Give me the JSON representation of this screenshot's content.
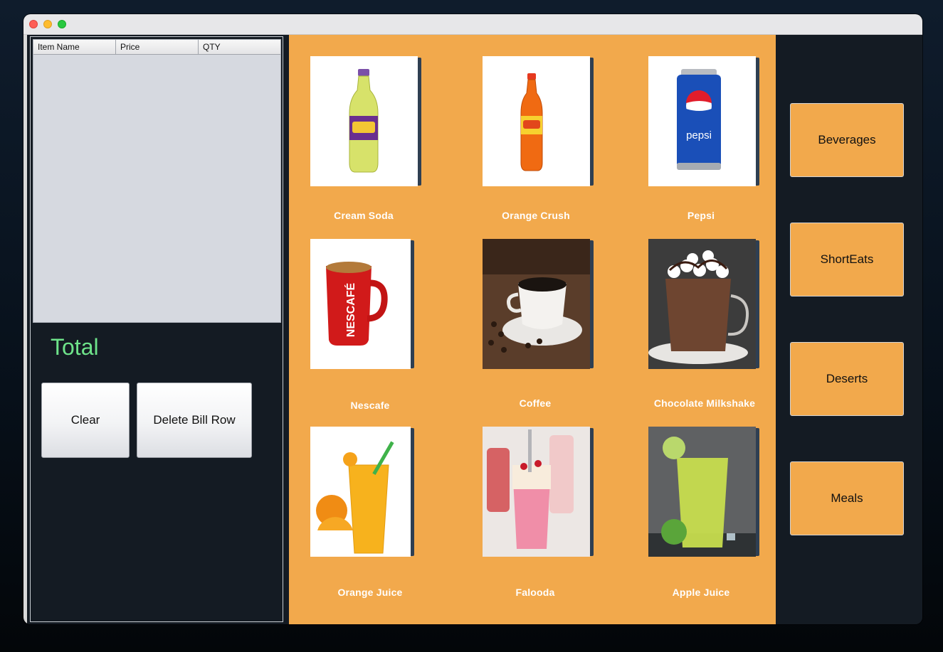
{
  "window": {
    "controls": [
      "close",
      "minimize",
      "zoom"
    ]
  },
  "bill_table": {
    "columns": [
      "Item Name",
      "Price",
      "QTY"
    ],
    "rows": []
  },
  "total_label": "Total",
  "buttons": {
    "clear": "Clear",
    "delete_row": "Delete Bill Row"
  },
  "products": [
    {
      "name": "Cream Soda",
      "image": "cream-soda-bottle"
    },
    {
      "name": "Orange Crush",
      "image": "orange-crush-bottle"
    },
    {
      "name": "Pepsi",
      "image": "pepsi-can"
    },
    {
      "name": "Nescafe",
      "image": "nescafe-mug"
    },
    {
      "name": "Coffee",
      "image": "coffee-cup"
    },
    {
      "name": "Chocolate Milkshake",
      "image": "chocolate-milkshake-glass"
    },
    {
      "name": "Orange Juice",
      "image": "orange-juice-glass"
    },
    {
      "name": "Falooda",
      "image": "falooda-glasses"
    },
    {
      "name": "Apple Juice",
      "image": "apple-juice-glass"
    }
  ],
  "categories": [
    "Beverages",
    "ShortEats",
    "Deserts",
    "Meals"
  ],
  "colors": {
    "accent": "#f2a94c",
    "panel_dark": "#141b23",
    "total_text": "#6ee38a"
  }
}
